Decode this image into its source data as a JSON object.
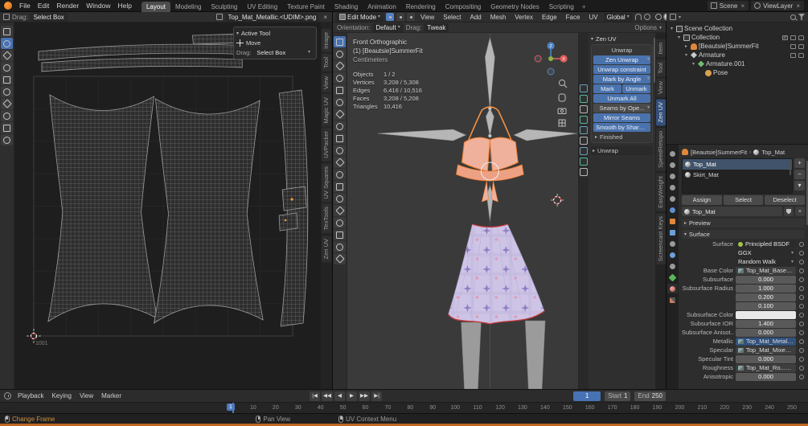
{
  "colors": {
    "accent_blue": "#4772b3",
    "blender_orange": "#e87d0d",
    "selection_orange": "#ff9a3c",
    "seam_red": "#cc3333"
  },
  "icons": {
    "dropdown": "▾",
    "collapse_open": "▾",
    "collapse_closed": "▸",
    "close": "×",
    "plus": "+",
    "minus": "−",
    "crumb_sep": "›",
    "check": "✓"
  },
  "topbar": {
    "menus": [
      "File",
      "Edit",
      "Render",
      "Window",
      "Help"
    ],
    "workspaces": [
      "Layout",
      "Modeling",
      "Sculpting",
      "UV Editing",
      "Texture Paint",
      "Shading",
      "Animation",
      "Rendering",
      "Compositing",
      "Geometry Nodes",
      "Scripting"
    ],
    "add_workspace": "+",
    "scene_name": "Scene",
    "view_layer_name": "ViewLayer"
  },
  "uv_editor": {
    "drag_label": "Drag:",
    "drag_value": "Select Box",
    "image_name": "Top_Mat_Metallic.<UDIM>.png",
    "udim_tile": "1001",
    "side_tabs": [
      "Image",
      "Tool",
      "View",
      "Magic UV",
      "UVPacker",
      "UV Squares",
      "TexTools",
      "Zen UV"
    ],
    "active_tool": {
      "title": "Active Tool",
      "tool_name": "Move",
      "drag_label": "Drag:",
      "drag_value": "Select Box"
    }
  },
  "viewport": {
    "mode": "Edit Mode",
    "menus": [
      "View",
      "Select",
      "Add",
      "Mesh",
      "Vertex",
      "Edge",
      "Face",
      "UV"
    ],
    "orientation": "Global",
    "tool_settings": {
      "orientation_label": "Orientation:",
      "orientation_value": "Default",
      "drag_label": "Drag:",
      "drag_value": "Tweak",
      "options_label": "Options"
    },
    "overlay": {
      "view_name": "Front Orthographic",
      "active_object": "(1) [Beautsie]SummerFit",
      "units": "Centimeters",
      "stats": {
        "objects_label": "Objects",
        "objects": "1 / 2",
        "vertices_label": "Vertices",
        "vertices": "3,208 / 5,308",
        "edges_label": "Edges",
        "edges": "6,416 / 10,516",
        "faces_label": "Faces",
        "faces": "3,208 / 5,208",
        "triangles_label": "Triangles",
        "triangles": "10,416"
      }
    },
    "axis_labels": {
      "x": "X",
      "y": "Y",
      "z": "Z"
    },
    "n_tabs": [
      "Item",
      "Tool",
      "View",
      "Zen UV",
      "SpeedRetopo",
      "EasyWeight",
      "Screencast Keys"
    ],
    "active_n_tab": "Zen UV"
  },
  "zen_uv": {
    "panel_title": "Zen UV",
    "section_title": "Unwrap",
    "btn_zen_unwrap": "Zen Unwrap",
    "btn_unwrap_constraint": "Unwrap constraint",
    "btn_mark_by_angle": "Mark by Angle",
    "btn_mark": "Mark",
    "btn_unmark": "Unmark",
    "btn_unmark_all": "Unmark All",
    "btn_seams_by": "Seams by Ope...",
    "btn_mirror_seams": "Mirror Seams",
    "btn_smooth_by_sharp": "Smooth by Sharp (To...",
    "collapsed_finished": "Finished",
    "collapsed_unwrap": "Unwrap"
  },
  "outliner": {
    "rows": [
      {
        "label": "Scene Collection"
      },
      {
        "label": "Collection"
      },
      {
        "label": "[Beautsie]SummerFit"
      },
      {
        "label": "Armature"
      },
      {
        "label": "Armature.001"
      },
      {
        "label": "Pose"
      }
    ]
  },
  "properties": {
    "breadcrumb": {
      "object": "[Beautsie]SummerFit",
      "material": "Top_Mat"
    },
    "slots": [
      "Top_Mat",
      "Skirt_Mat"
    ],
    "assign": "Assign",
    "select": "Select",
    "deselect": "Deselect",
    "material_name": "Top_Mat",
    "preview_title": "Preview",
    "surface_title": "Surface",
    "surface_label": "Surface",
    "shader": "Principled BSDF",
    "distribution": "GGX",
    "subsurface_method": "Random Walk",
    "rows": {
      "base_color_label": "Base Color",
      "base_color": "Top_Mat_BaseColor.<UD...",
      "subsurface_label": "Subsurface",
      "subsurface": "0.000",
      "subsurface_radius_label": "Subsurface Radius",
      "radius_x": "1.000",
      "radius_y": "0.200",
      "radius_z": "0.100",
      "subsurface_color_label": "Subsurface Color",
      "subsurface_ior_label": "Subsurface IOR",
      "subsurface_ior": "1.400",
      "subsurface_aniso_label": "Subsurface Anisot...",
      "subsurface_aniso": "0.000",
      "metallic_label": "Metallic",
      "metallic": "Top_Mat_Metallic.<UDIM...",
      "specular_label": "Specular",
      "specular": "Top_Mat_Mixed_AO.<UD...",
      "specular_tint_label": "Specular Tint",
      "specular_tint": "0.000",
      "roughness_label": "Roughness",
      "roughness": "Top_Mat_Ro...<UDIM>.png",
      "anisotropic_label": "Anisotropic",
      "anisotropic": "0.000"
    }
  },
  "timeline": {
    "menus": [
      "Playback",
      "Keying",
      "View",
      "Marker"
    ],
    "transport": [
      "|◀",
      "◀◀",
      "◀",
      "▶",
      "▶▶",
      "▶|"
    ],
    "current_frame": "1",
    "start_label": "Start",
    "start": "1",
    "end_label": "End",
    "end": "250",
    "ticks": [
      "0",
      "10",
      "20",
      "30",
      "40",
      "50",
      "60",
      "70",
      "80",
      "90",
      "100",
      "110",
      "120",
      "130",
      "140",
      "150",
      "160",
      "170",
      "180",
      "190",
      "200",
      "210",
      "220",
      "230",
      "240",
      "250"
    ]
  },
  "statusbar": {
    "hints": [
      "Change Frame",
      "Pan View",
      "UV Context Menu"
    ]
  }
}
